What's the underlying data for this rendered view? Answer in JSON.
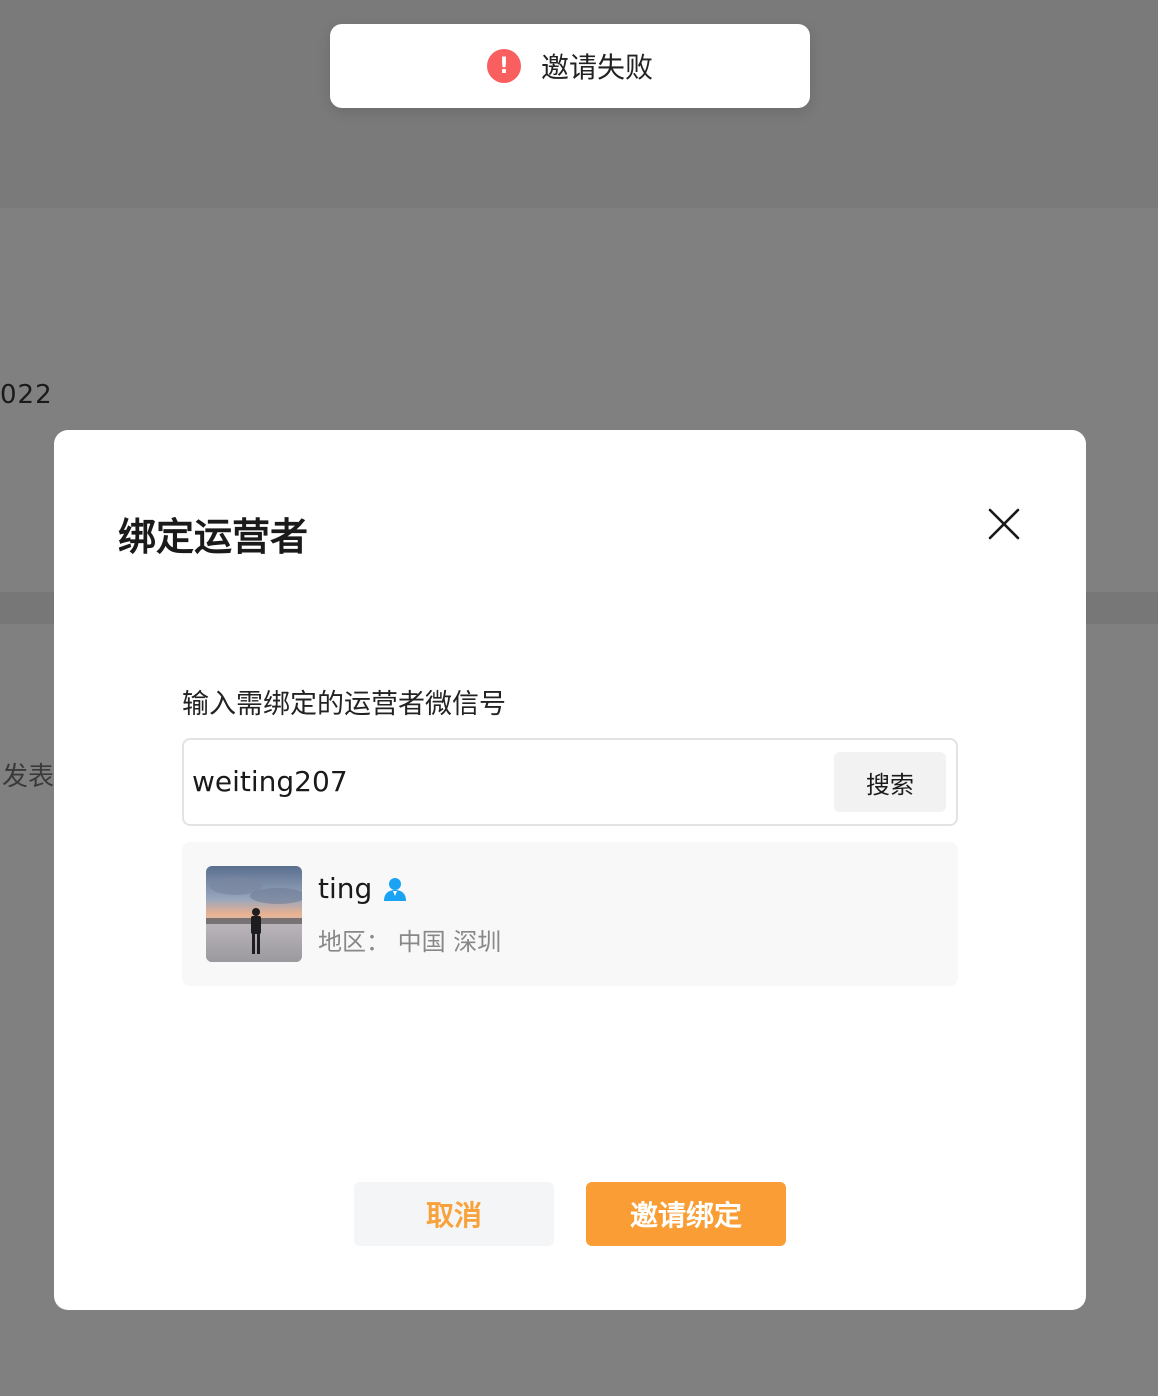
{
  "background": {
    "year_fragment": "022",
    "publish_fragment": "发表"
  },
  "toast": {
    "icon": "error-icon",
    "icon_glyph": "!",
    "message": "邀请失败",
    "icon_color": "#fa5f5f"
  },
  "modal": {
    "title": "绑定运营者",
    "close_icon": "close-icon",
    "field_label": "输入需绑定的运营者微信号",
    "search": {
      "value": "weiting207",
      "button_label": "搜索"
    },
    "result": {
      "name": "ting",
      "name_icon": "person-icon",
      "region": "地区：  中国 深圳"
    },
    "actions": {
      "cancel_label": "取消",
      "invite_label": "邀请绑定"
    },
    "accent_color": "#f99d34"
  }
}
